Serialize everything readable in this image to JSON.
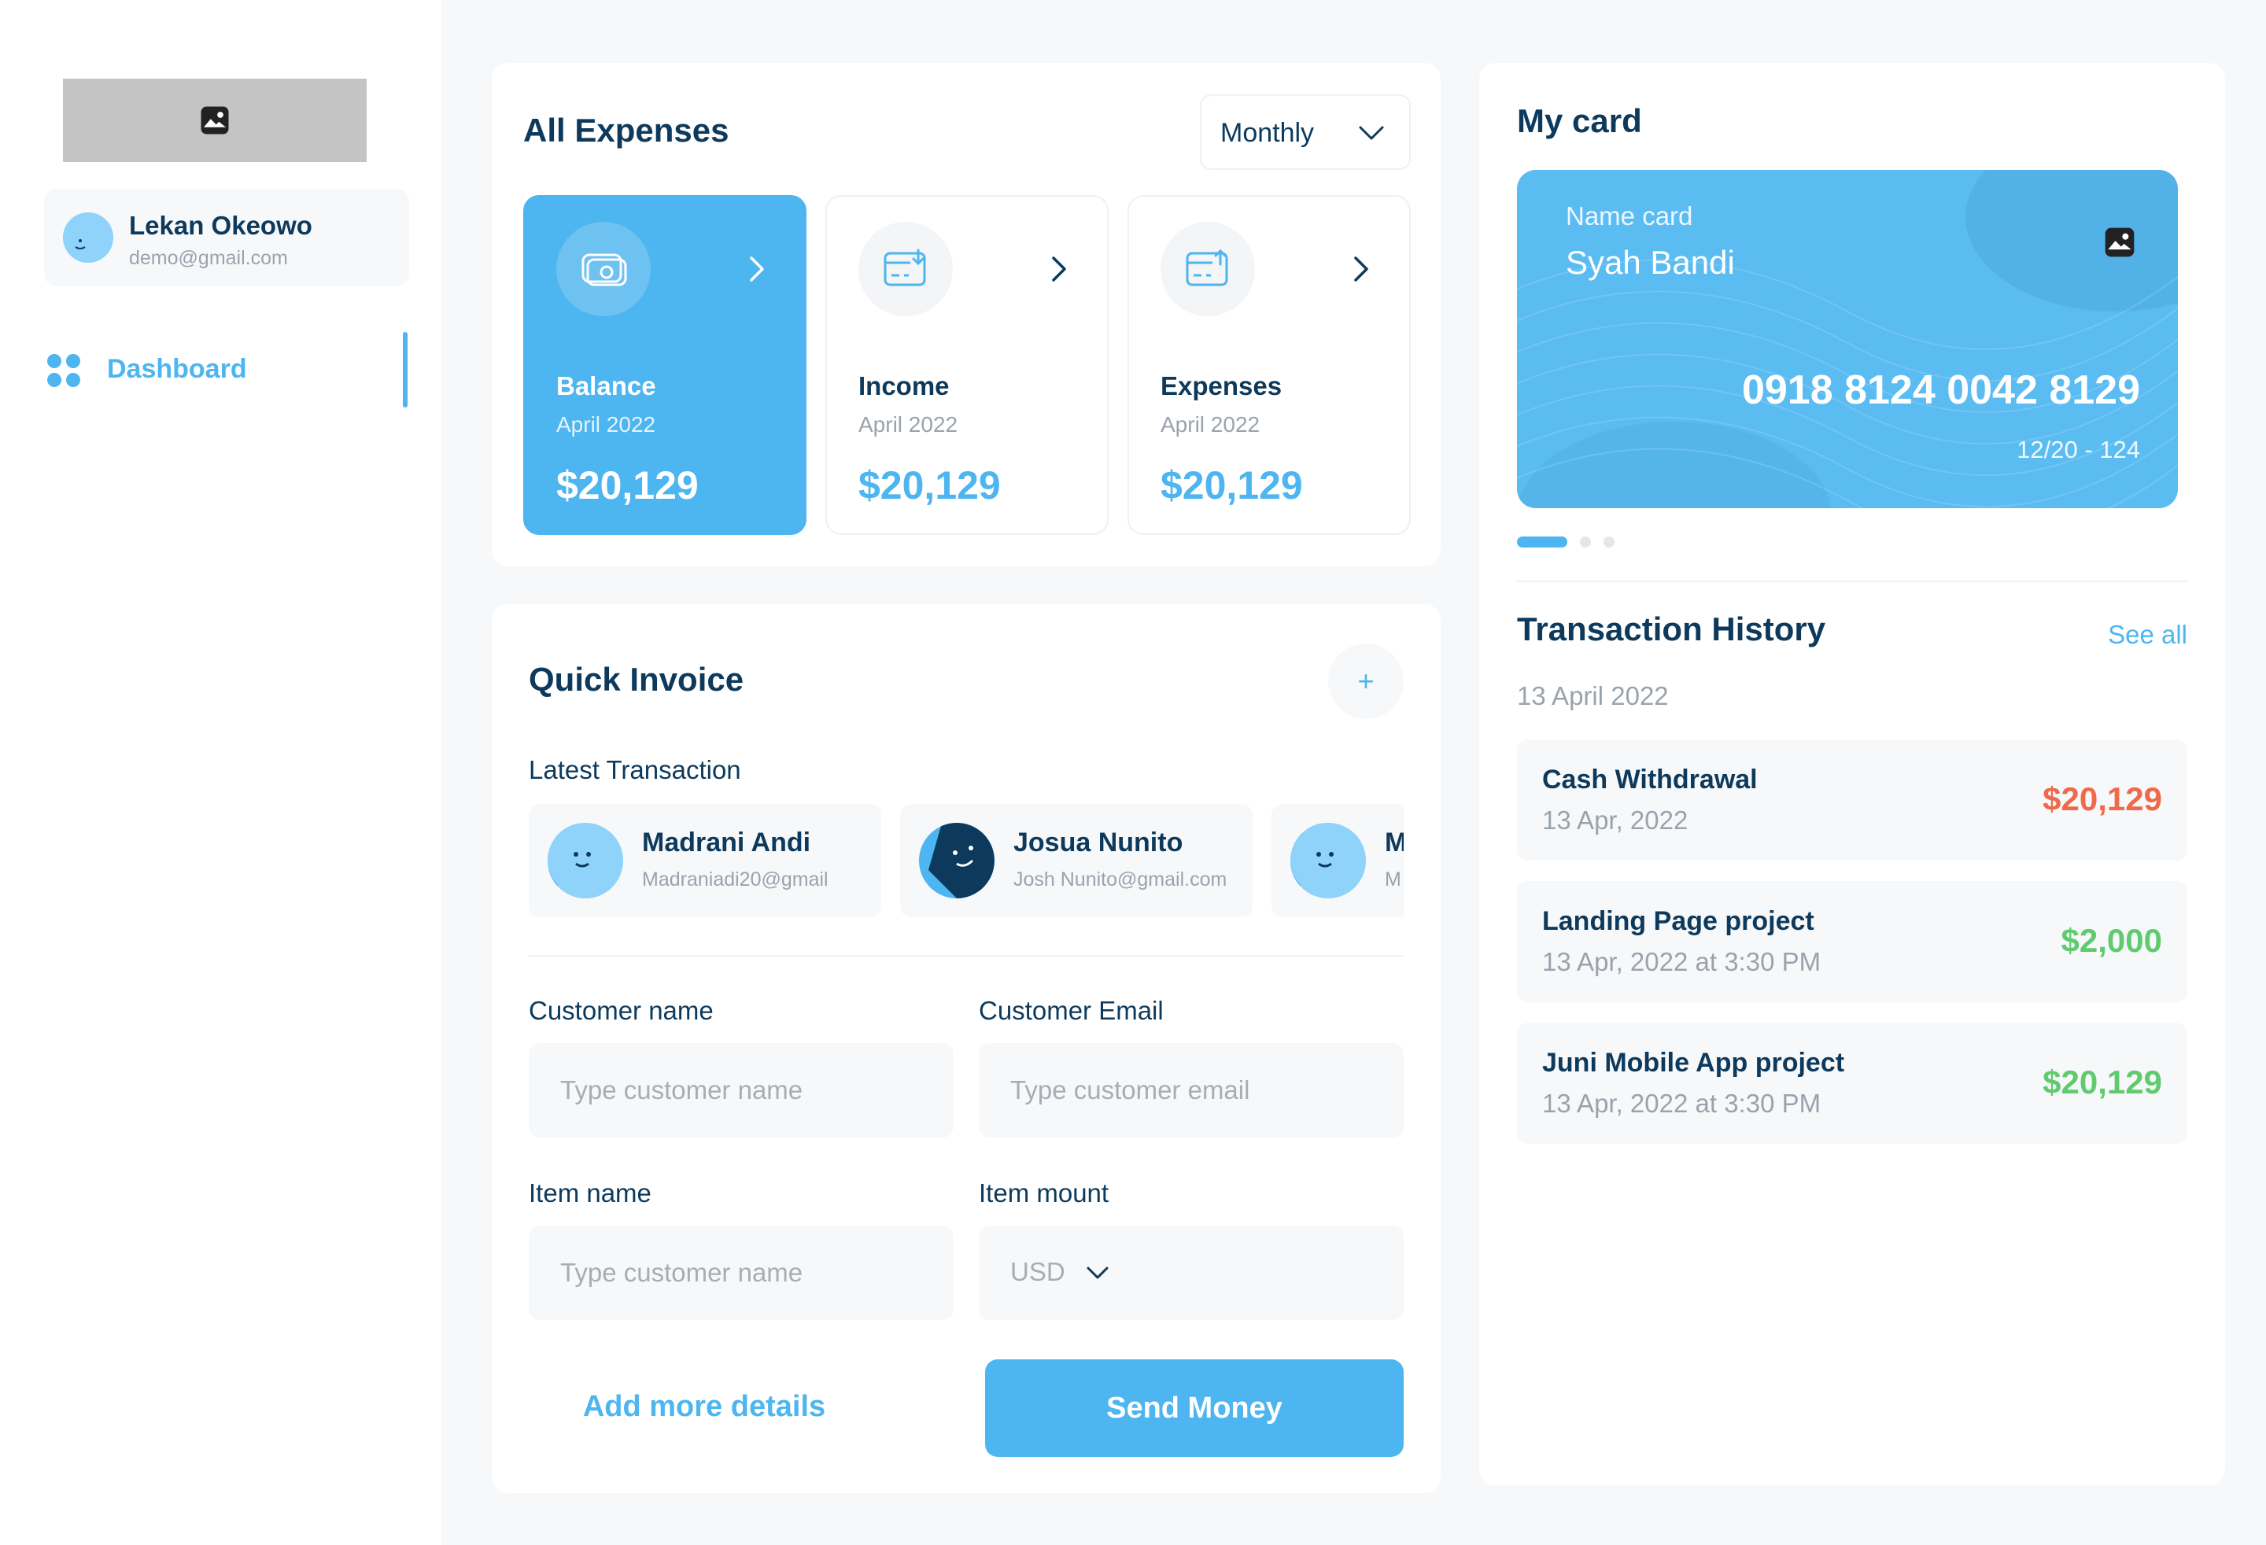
{
  "sidebar": {
    "logo_icon": "image-placeholder-icon",
    "user": {
      "name": "Lekan Okeowo",
      "email": "demo@gmail.com"
    },
    "nav": [
      {
        "label": "Dashboard",
        "icon": "grid-icon",
        "active": true
      }
    ]
  },
  "expenses": {
    "title": "All Expenses",
    "period_select": "Monthly",
    "stats": [
      {
        "label": "Balance",
        "date": "April 2022",
        "value": "$20,129",
        "icon": "wallet-icon"
      },
      {
        "label": "Income",
        "date": "April 2022",
        "value": "$20,129",
        "icon": "income-icon"
      },
      {
        "label": "Expenses",
        "date": "April 2022",
        "value": "$20,129",
        "icon": "expense-icon"
      }
    ]
  },
  "invoice": {
    "title": "Quick Invoice",
    "latest_label": "Latest Transaction",
    "contacts": [
      {
        "name": "Madrani Andi",
        "email": "Madraniadi20@gmail"
      },
      {
        "name": "Josua Nunito",
        "email": "Josh Nunito@gmail.com"
      },
      {
        "name": "M",
        "email": "M"
      }
    ],
    "customer_name": {
      "label": "Customer name",
      "placeholder": "Type customer name"
    },
    "customer_email": {
      "label": "Customer Email",
      "placeholder": "Type customer email"
    },
    "item_name": {
      "label": "Item name",
      "placeholder": "Type customer name"
    },
    "item_amount": {
      "label": "Item mount",
      "currency": "USD"
    },
    "add_more": "Add more details",
    "send": "Send Money"
  },
  "card": {
    "title": "My card",
    "name_label": "Name card",
    "holder": "Syah Bandi",
    "number": "0918 8124 0042 8129",
    "expiry": "12/20  -  124",
    "active_slide": 1,
    "slide_count": 3
  },
  "history": {
    "title": "Transaction History",
    "see_all": "See all",
    "date": "13 April 2022",
    "items": [
      {
        "title": "Cash Withdrawal",
        "date": "13 Apr, 2022",
        "amount": "$20,129",
        "color": "#ef6a4a"
      },
      {
        "title": "Landing Page project",
        "date": "13 Apr, 2022 at 3:30 PM",
        "amount": "$2,000",
        "color": "#5fcb6e"
      },
      {
        "title": "Juni Mobile App project",
        "date": "13 Apr, 2022 at 3:30 PM",
        "amount": "$20,129",
        "color": "#5fcb6e"
      }
    ]
  },
  "colors": {
    "accent": "#4db5ef",
    "text": "#0d3a5c",
    "muted": "#9aa3ad",
    "negative": "#ef6a4a",
    "positive": "#5fcb6e"
  }
}
